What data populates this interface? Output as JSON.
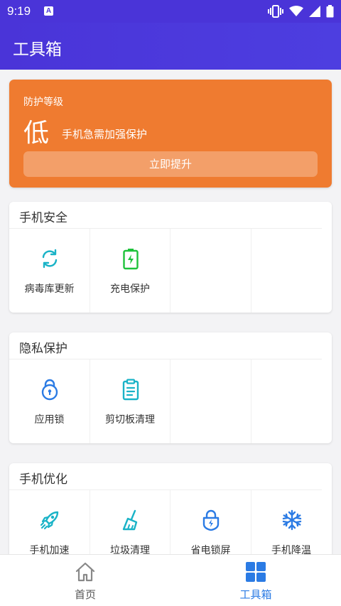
{
  "status": {
    "time": "9:19",
    "notif_letter": "A"
  },
  "appbar": {
    "title": "工具箱"
  },
  "protection": {
    "label": "防护等级",
    "level": "低",
    "description": "手机急需加强保护",
    "button": "立即提升"
  },
  "sections": [
    {
      "title": "手机安全",
      "items": [
        {
          "label": "病毒库更新",
          "icon": "refresh-icon"
        },
        {
          "label": "充电保护",
          "icon": "battery-charging-icon"
        }
      ]
    },
    {
      "title": "隐私保护",
      "items": [
        {
          "label": "应用锁",
          "icon": "lock-icon"
        },
        {
          "label": "剪切板清理",
          "icon": "clipboard-icon"
        }
      ]
    },
    {
      "title": "手机优化",
      "items": [
        {
          "label": "手机加速",
          "icon": "rocket-icon"
        },
        {
          "label": "垃圾清理",
          "icon": "broom-icon"
        },
        {
          "label": "省电锁屏",
          "icon": "shield-lock-bolt-icon"
        },
        {
          "label": "手机降温",
          "icon": "snowflake-icon"
        }
      ]
    }
  ],
  "nav": {
    "home": "首页",
    "toolbox": "工具箱"
  },
  "colors": {
    "primary": "#4a34d8",
    "orange": "#ef7b30",
    "green": "#1ec23b",
    "blue": "#2b7be4",
    "teal": "#1ab3c7"
  }
}
